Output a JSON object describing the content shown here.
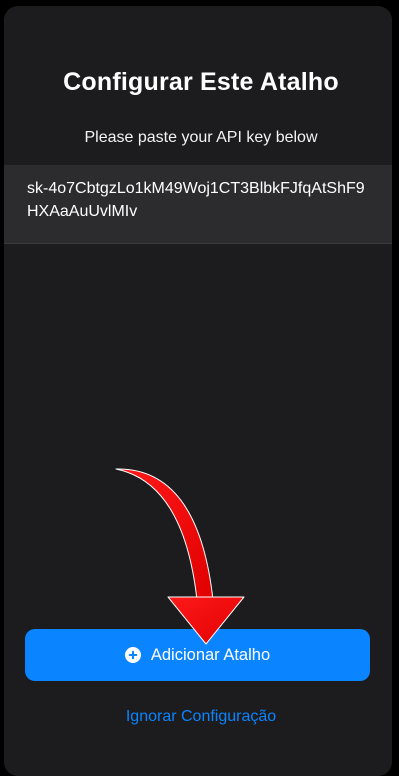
{
  "sheet": {
    "title": "Configurar Este Atalho",
    "subtitle": "Please paste your API key below",
    "api_key_value": "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"
  },
  "actions": {
    "add_label": "Adicionar Atalho",
    "add_icon": "plus-circle-icon",
    "ignore_label": "Ignorar Configuração"
  },
  "annotation": {
    "icon": "red-arrow-icon",
    "color": "#ff0000"
  },
  "colors": {
    "accent": "#0a84ff",
    "sheet_background": "#1c1c1e",
    "field_background": "#2c2c2e"
  }
}
